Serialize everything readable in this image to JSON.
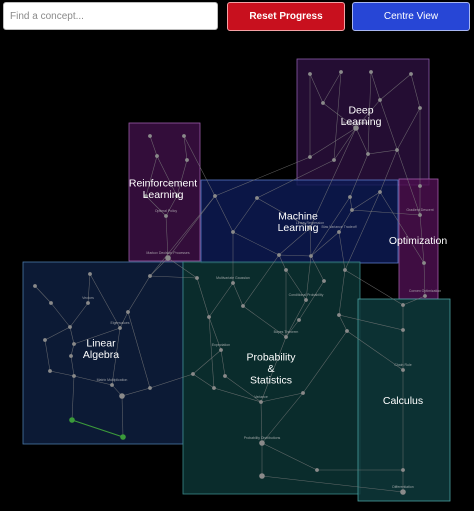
{
  "toolbar": {
    "search_placeholder": "Find a concept...",
    "reset_label": "Reset Progress",
    "centre_label": "Centre View"
  },
  "clusters": [
    {
      "id": "deep-learning",
      "label": [
        "Deep",
        "Learning"
      ],
      "fill": "#2a0f3c",
      "stroke": "#8a5aa8"
    },
    {
      "id": "reinforcement-learning",
      "label": [
        "Reinforcement",
        "Learning"
      ],
      "fill": "#3c0f44",
      "stroke": "#9a5aa8"
    },
    {
      "id": "optimization",
      "label": [
        "Optimization"
      ],
      "fill": "#4a0f4e",
      "stroke": "#a05aa8"
    },
    {
      "id": "machine-learning",
      "label": [
        "Machine",
        "Learning"
      ],
      "fill": "#0d1a52",
      "stroke": "#5a78c8"
    },
    {
      "id": "linear-algebra",
      "label": [
        "Linear",
        "Algebra"
      ],
      "fill": "#0e1e3e",
      "stroke": "#4a78a8"
    },
    {
      "id": "probability-statistics",
      "label": [
        "Probability",
        "&",
        "Statistics"
      ],
      "fill": "#0c3434",
      "stroke": "#3a8a8a"
    },
    {
      "id": "calculus",
      "label": [
        "Calculus"
      ],
      "fill": "#0e3a3c",
      "stroke": "#4aa0a0"
    }
  ],
  "node_labels": [
    "Backpropagation",
    "Markov Decision Processes",
    "Optimal Policy",
    "Gradient Descent",
    "Convex Optimization",
    "Multivariate Gaussian",
    "Eigenvalues",
    "Matrix Multiplication",
    "Probability Distributions",
    "Differentiation",
    "Variance",
    "Expectation",
    "Linear Regression",
    "Bias Variance Tradeoff",
    "Vectors",
    "Chain Rule",
    "Conditional Probability",
    "Bayes Theorem"
  ],
  "colors": {
    "edge": "#7c7c7c",
    "node": "#8a8a8a",
    "completed": "#3a9a3a"
  }
}
